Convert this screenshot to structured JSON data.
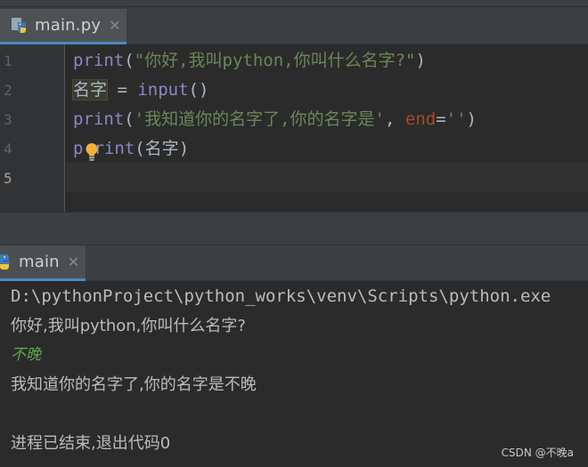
{
  "editor": {
    "tab": {
      "label": "main.py",
      "close": "✕",
      "icon": "python-file-icon"
    },
    "line_numbers": [
      "1",
      "2",
      "3",
      "4",
      "5"
    ],
    "lines": [
      {
        "print": "print",
        "open": "(",
        "string": "\"你好,我叫python,你叫什么名字?\"",
        "close": ")"
      },
      {
        "ident": "名字",
        "assign": " = ",
        "func": "input",
        "parens": "()"
      },
      {
        "print": "print",
        "open": "(",
        "string": "'我知道你的名字了,你的名字是'",
        "comma": ", ",
        "kwarg": "end",
        "eq": "=",
        "string2": "''",
        "close": ")"
      },
      {
        "p": "p",
        "rint": "rint",
        "open": "(",
        "arg": "名字",
        "close": ")"
      }
    ]
  },
  "run": {
    "tab": {
      "label": "main",
      "close": "✕",
      "icon": "python-run-icon"
    },
    "output": [
      "D:\\pythonProject\\python_works\\venv\\Scripts\\python.exe",
      "你好,我叫python,你叫什么名字?",
      "不晚",
      "我知道你的名字了,你的名字是不晚",
      "",
      "进程已结束,退出代码0"
    ]
  },
  "watermark": "CSDN @不晚a",
  "colors": {
    "background": "#2b2b2b",
    "keyword": "#8888c6",
    "string": "#6a8759",
    "kwarg": "#aa4926",
    "user_input": "#5ca64b",
    "tab_accent": "#4a88c7"
  }
}
